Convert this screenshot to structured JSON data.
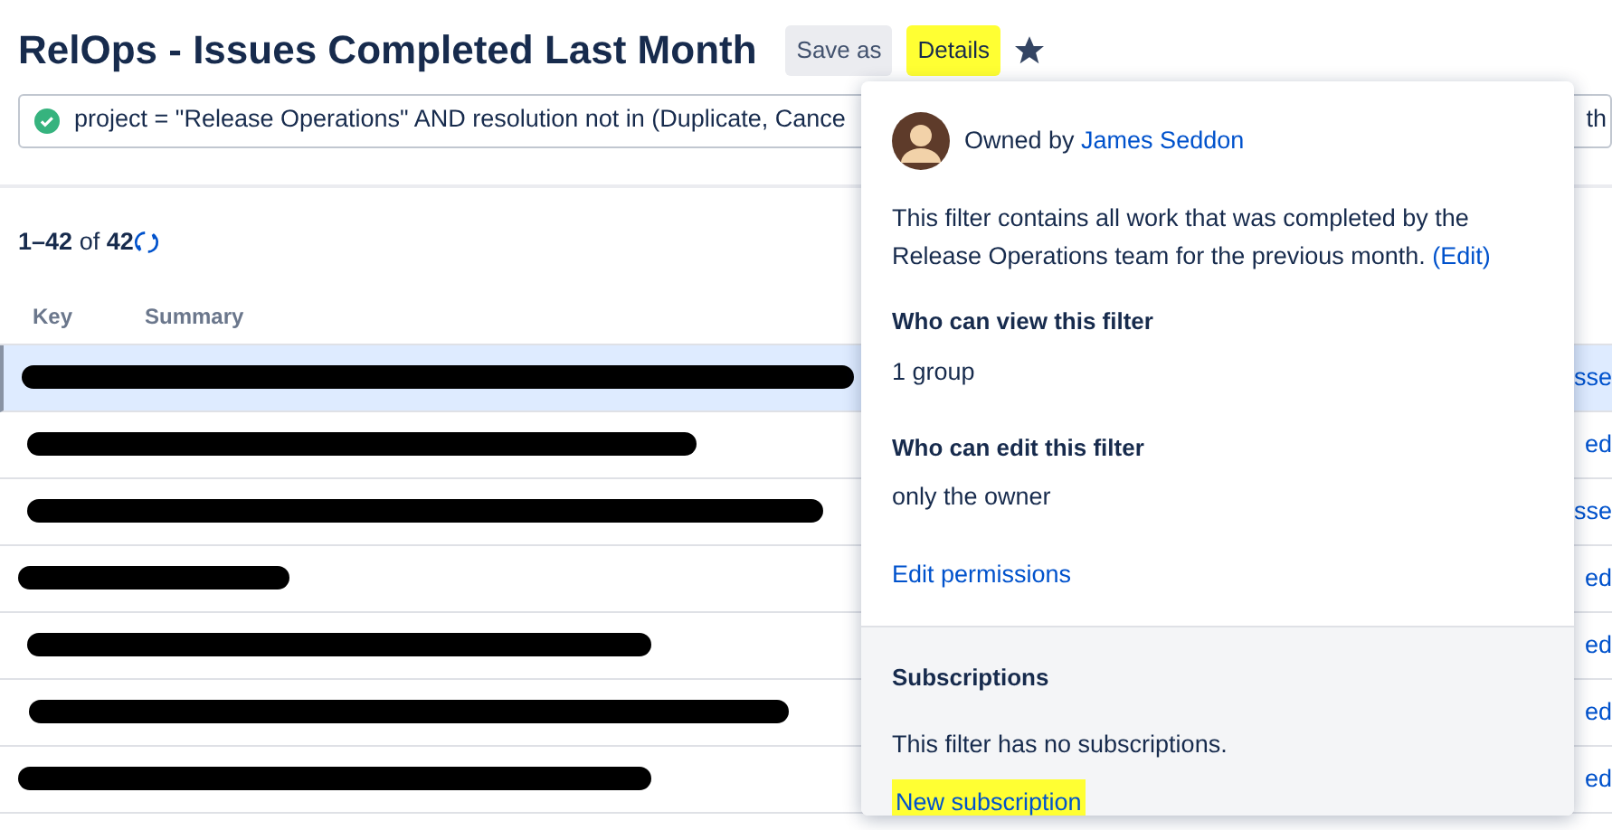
{
  "header": {
    "title": "RelOps - Issues Completed Last Month",
    "buttons": [
      {
        "label": "Save as",
        "highlighted": false
      },
      {
        "label": "Details",
        "highlighted": true
      }
    ],
    "starred": true
  },
  "query": {
    "valid": true,
    "text": "project = \"Release Operations\" AND resolution not in (Duplicate, Cance",
    "end_text": "th"
  },
  "results": {
    "range": "1–42",
    "of": "of",
    "total": "42"
  },
  "table": {
    "columns": [
      "Key",
      "Summary"
    ],
    "rows": [
      {
        "selected": true,
        "redacted": true,
        "end_text": "sse"
      },
      {
        "selected": false,
        "redacted": true,
        "end_text": "ed"
      },
      {
        "selected": false,
        "redacted": true,
        "end_text": "sse"
      },
      {
        "selected": false,
        "redacted": true,
        "end_text": "ed"
      },
      {
        "selected": false,
        "redacted": true,
        "end_text": "ed"
      },
      {
        "selected": false,
        "redacted": true,
        "end_text": "ed"
      },
      {
        "selected": false,
        "redacted": true,
        "end_text": "ed"
      }
    ]
  },
  "details_popup": {
    "owner_label": "Owned by",
    "owner_name": "James Seddon",
    "description": "This filter contains all work that was completed by the Release Operations team for the previous month.",
    "edit_link": "(Edit)",
    "sections": [
      {
        "heading": "Who can view this filter",
        "value": "1 group"
      },
      {
        "heading": "Who can edit this filter",
        "value": "only the owner"
      }
    ],
    "edit_permissions": {
      "label": "Edit permissions",
      "highlighted": false
    },
    "subscriptions": {
      "heading": "Subscriptions",
      "empty_text": "This filter has no subscriptions.",
      "new_link": {
        "label": "New subscription",
        "highlighted": true
      }
    }
  }
}
